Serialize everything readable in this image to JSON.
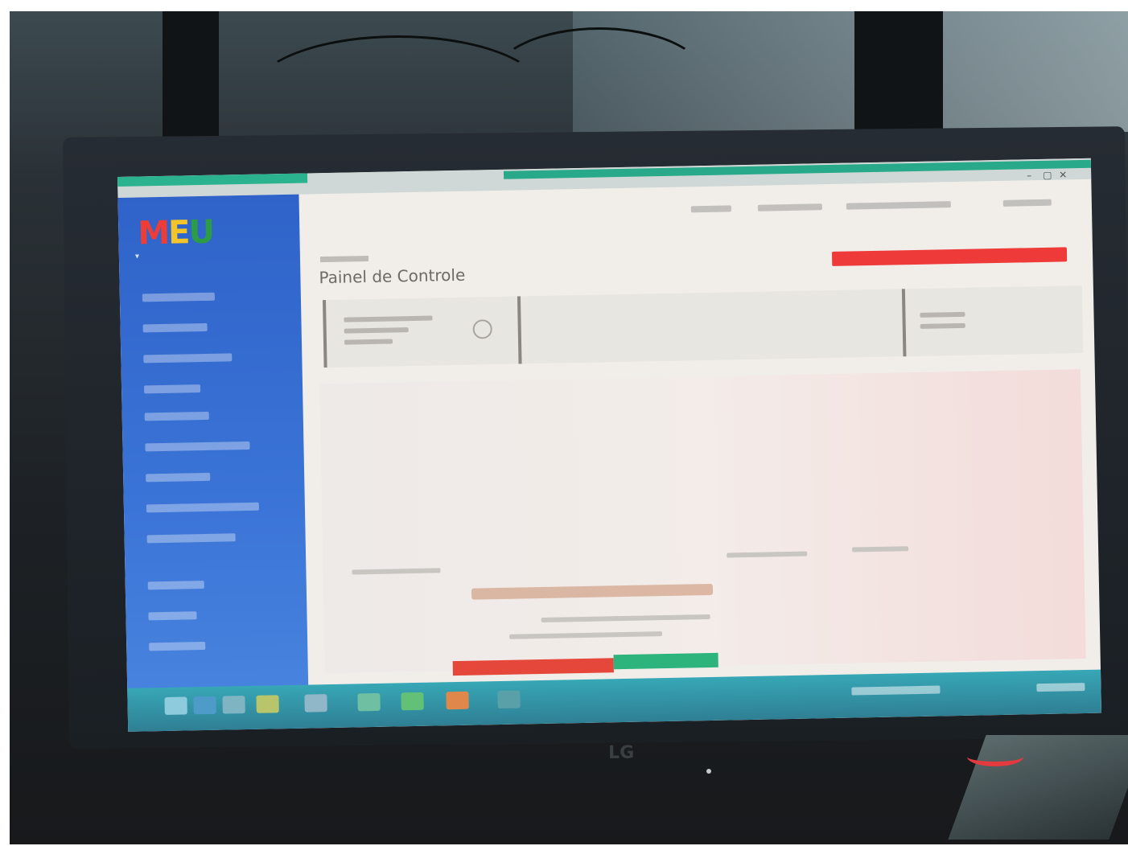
{
  "caption": "",
  "monitor": {
    "brand": "",
    "logo": "LG"
  },
  "app": {
    "logo_letters": [
      "M",
      "E",
      "U"
    ],
    "page_title": "Painel de Controle",
    "taskbar_apps": 9
  }
}
